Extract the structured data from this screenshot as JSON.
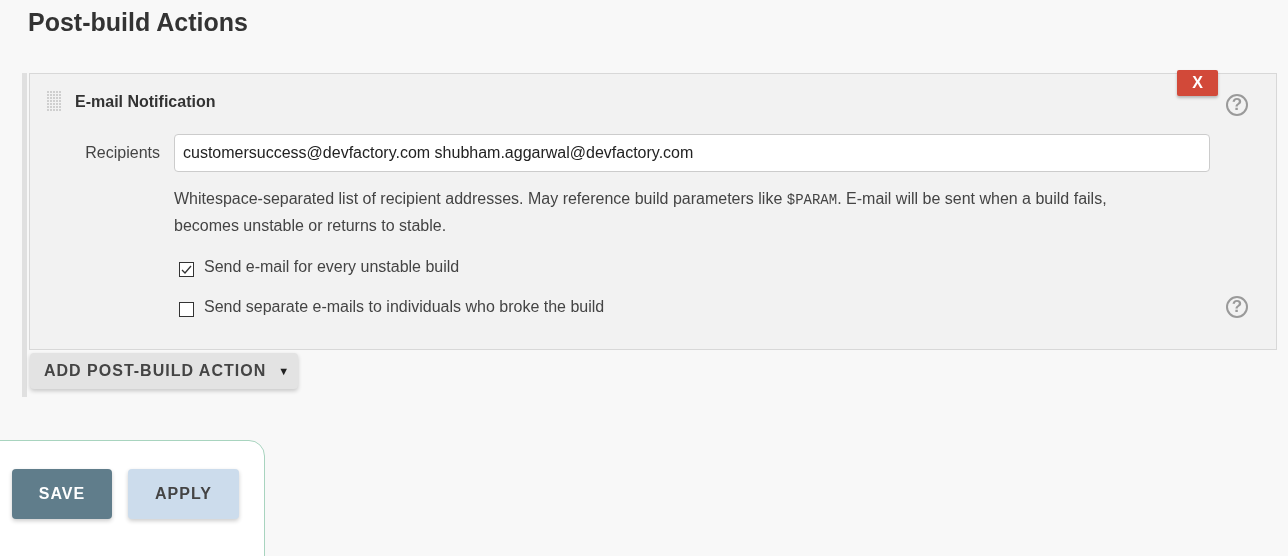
{
  "section_title": "Post-build Actions",
  "action": {
    "title": "E-mail Notification",
    "delete_label": "X",
    "help": "?",
    "recipients": {
      "label": "Recipients",
      "value": "customersuccess@devfactory.com shubham.aggarwal@devfactory.com"
    },
    "description": [
      {
        "kind": "text",
        "text": "Whitespace-separated list of recipient addresses. May reference build parameters like "
      },
      {
        "kind": "code",
        "text": "$PARAM"
      },
      {
        "kind": "text",
        "text": ". E-mail will be sent when a build fails, becomes unstable or returns to stable."
      }
    ],
    "options": [
      {
        "label": "Send e-mail for every unstable build",
        "checked": true
      },
      {
        "label": "Send separate e-mails to individuals who broke the build",
        "checked": false,
        "help": "?"
      }
    ]
  },
  "add_button": {
    "label": "ADD POST-BUILD ACTION",
    "caret": "▼"
  },
  "buttons": [
    {
      "label": "SAVE",
      "kind": "primary"
    },
    {
      "label": "APPLY",
      "kind": "secondary"
    }
  ]
}
